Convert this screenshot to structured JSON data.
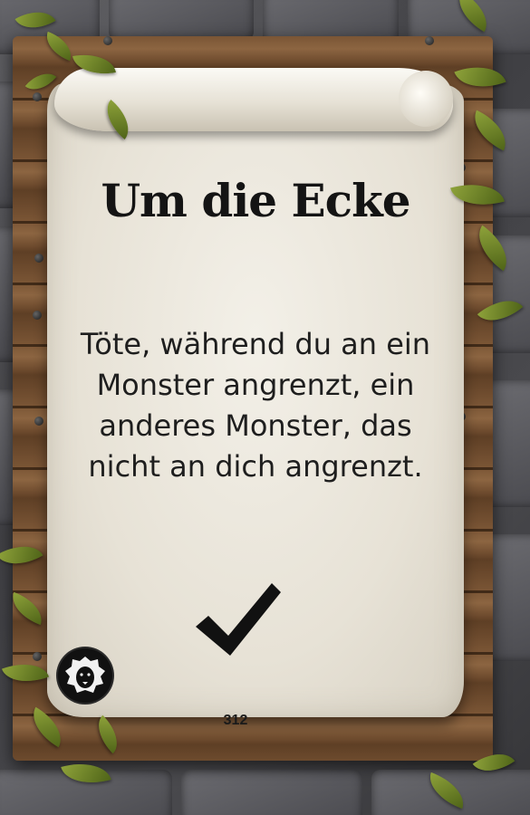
{
  "card": {
    "title": "Um die Ecke",
    "text": "Töte, während du an ein Monster angrenzt, ein anderes Monster, das nicht an dich angrenzt.",
    "number": "312",
    "completed_icon": "checkmark-icon",
    "faction_icon": "lion-emblem-icon"
  },
  "colors": {
    "parchment": "#ebe6da",
    "wood": "#7a5535",
    "stone": "#4a4a4f",
    "vine": "#6f8a2a",
    "ink": "#141414"
  }
}
